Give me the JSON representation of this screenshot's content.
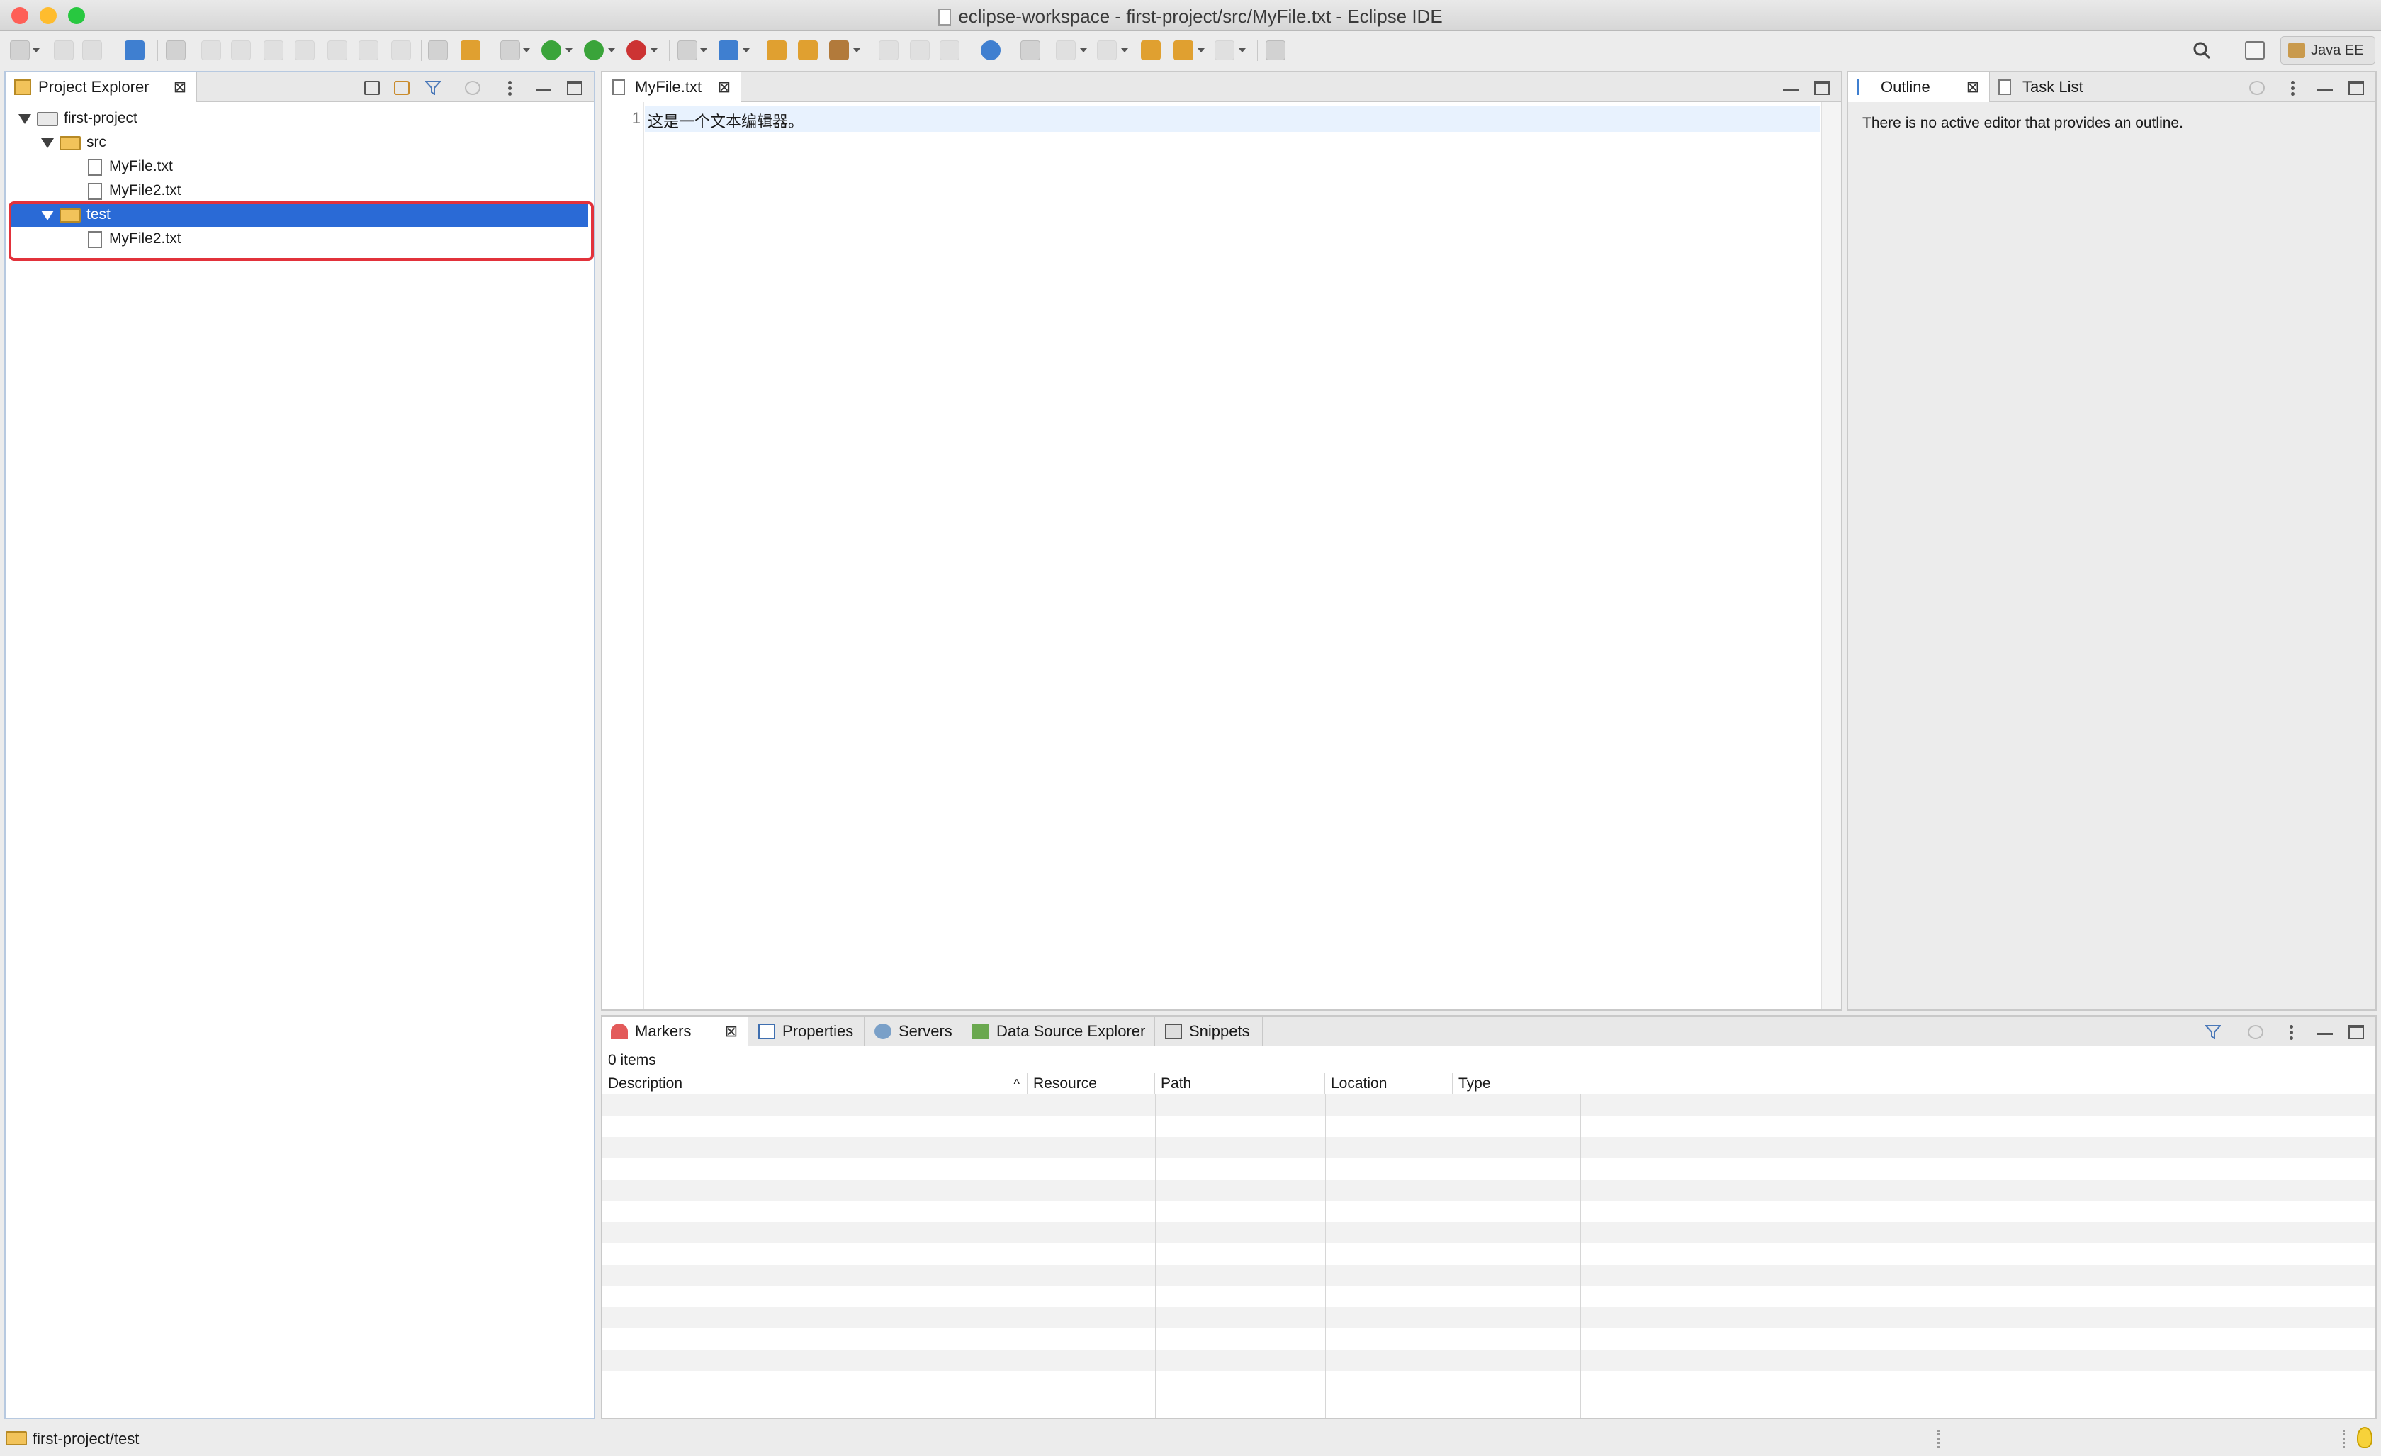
{
  "window": {
    "title": "eclipse-workspace - first-project/src/MyFile.txt - Eclipse IDE",
    "traffic_colors": [
      "#fe5f57",
      "#febc2e",
      "#28c840"
    ]
  },
  "toolbar": {
    "perspective_label": "Java EE"
  },
  "project_explorer": {
    "tab_label": "Project Explorer",
    "tree": {
      "project": "first-project",
      "src_folder": "src",
      "src_files": [
        "MyFile.txt",
        "MyFile2.txt"
      ],
      "test_folder": "test",
      "test_files": [
        "MyFile2.txt"
      ]
    }
  },
  "editor": {
    "tab_label": "MyFile.txt",
    "line_number": "1",
    "content": "这是一个文本编辑器。"
  },
  "outline": {
    "tab_label": "Outline",
    "tasklist_tab_label": "Task List",
    "message": "There is no active editor that provides an outline."
  },
  "bottom_panel": {
    "tabs": [
      "Markers",
      "Properties",
      "Servers",
      "Data Source Explorer",
      "Snippets"
    ],
    "items_count": "0 items",
    "columns": [
      "Description",
      "Resource",
      "Path",
      "Location",
      "Type"
    ]
  },
  "status_bar": {
    "text": "first-project/test"
  },
  "colors": {
    "selection": "#2a6ad6",
    "highlight_border": "#e2323b"
  }
}
